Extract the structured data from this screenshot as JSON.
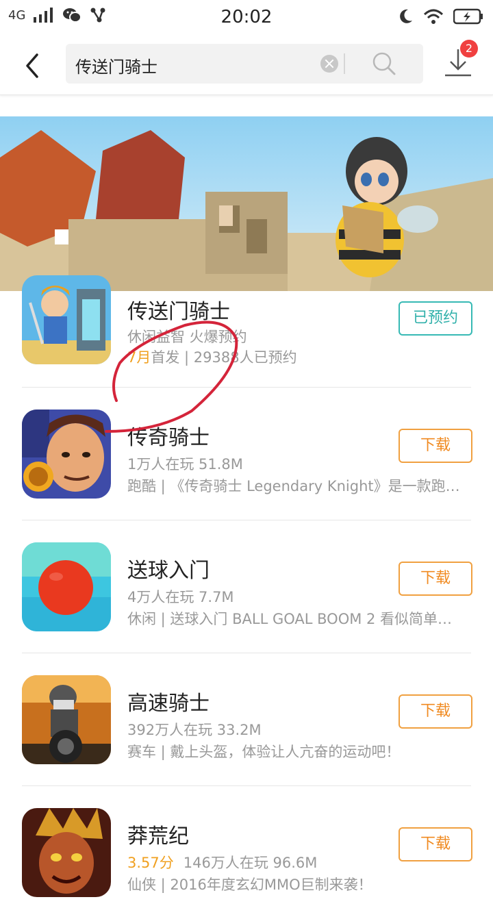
{
  "status_bar": {
    "network": "4G",
    "time": "20:02"
  },
  "header": {
    "search_value": "传送门骑士",
    "download_badge": "2"
  },
  "apps": [
    {
      "title": "传送门骑士",
      "line2": "休闲益智  火爆预约",
      "line3_accent": "7月",
      "line3": "首发 | 29388人已预约",
      "button": "已预约",
      "button_state": "reserved"
    },
    {
      "title": "传奇骑士",
      "line2": "1万人在玩  51.8M",
      "line3": "跑酷 | 《传奇骑士 Legendary Knight》是一款跑…",
      "button": "下载"
    },
    {
      "title": "送球入门",
      "line2": "4万人在玩  7.7M",
      "line3": "休闲 | 送球入门 BALL GOAL BOOM 2 看似简单…",
      "button": "下载"
    },
    {
      "title": "高速骑士",
      "line2": "392万人在玩  33.2M",
      "line3": "赛车 | 戴上头盔，体验让人亢奋的运动吧！",
      "button": "下载"
    },
    {
      "title": "莽荒纪",
      "rating": "3.57分",
      "line2": "146万人在玩  96.6M",
      "line3": "仙侠 | 2016年度玄幻MMO巨制来袭！",
      "button": "下载"
    }
  ]
}
